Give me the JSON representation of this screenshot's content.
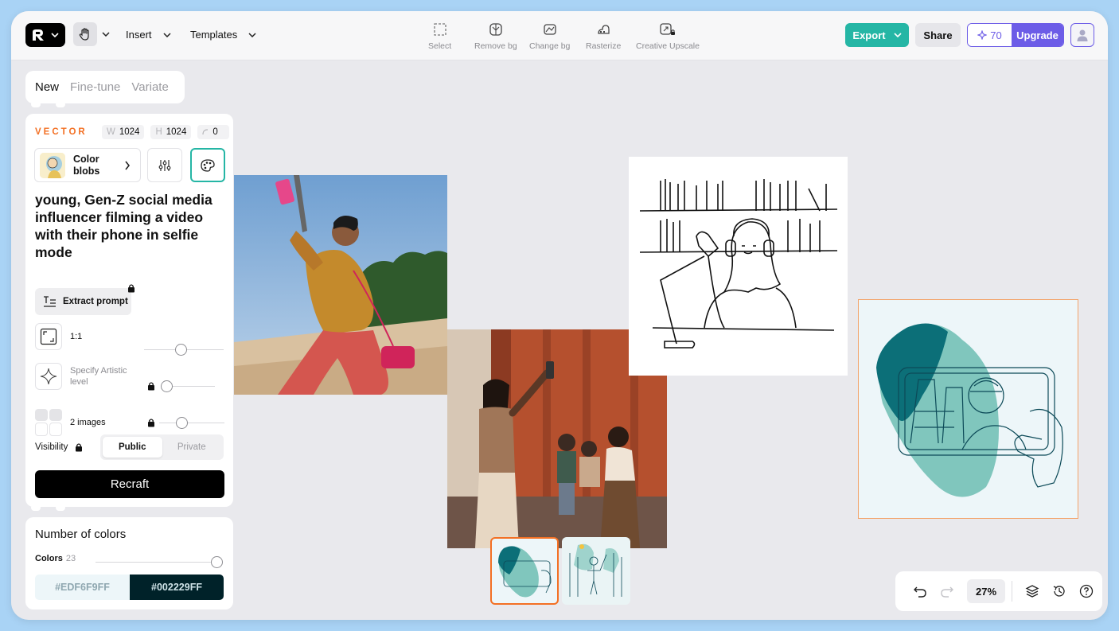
{
  "topbar": {
    "menus": [
      "Insert",
      "Templates"
    ],
    "tools": [
      {
        "label": "Select",
        "icon": "select-icon"
      },
      {
        "label": "Remove bg",
        "icon": "remove-bg-icon"
      },
      {
        "label": "Change bg",
        "icon": "change-bg-icon"
      },
      {
        "label": "Rasterize",
        "icon": "rasterize-icon"
      },
      {
        "label": "Creative Upscale",
        "icon": "creative-upscale-icon"
      }
    ],
    "export_label": "Export",
    "share_label": "Share",
    "credits": "70",
    "upgrade_label": "Upgrade"
  },
  "tabs": [
    "New",
    "Fine-tune",
    "Variate"
  ],
  "panel": {
    "model_label": "VECTOR",
    "width_key": "W",
    "width": "1024",
    "height_key": "H",
    "height": "1024",
    "seed": "0",
    "style_name": "Color blobs",
    "prompt": "young, Gen-Z social media influencer filming a video with their phone in selfie mode",
    "extract_label": "Extract prompt",
    "aspect_label": "1:1",
    "artistic_label": "Specify Artistic level",
    "images_label": "2 images",
    "visibility_label": "Visibility",
    "visibility_options": [
      "Public",
      "Private"
    ],
    "recraft_label": "Recraft"
  },
  "colors": {
    "title": "Number of colors",
    "label": "Colors",
    "count": "23",
    "swatches": [
      {
        "hex": "#EDF6F9FF",
        "color": "#edf6f9",
        "text_color": "#8fa7b0"
      },
      {
        "hex": "#002229FF",
        "color": "#002229",
        "text_color": "#cfe3e8"
      }
    ]
  },
  "bottombar": {
    "zoom": "27%"
  },
  "colors_theme": {
    "accent": "#25b6a5",
    "upgrade": "#6c5ce7",
    "selection": "#f37024"
  }
}
